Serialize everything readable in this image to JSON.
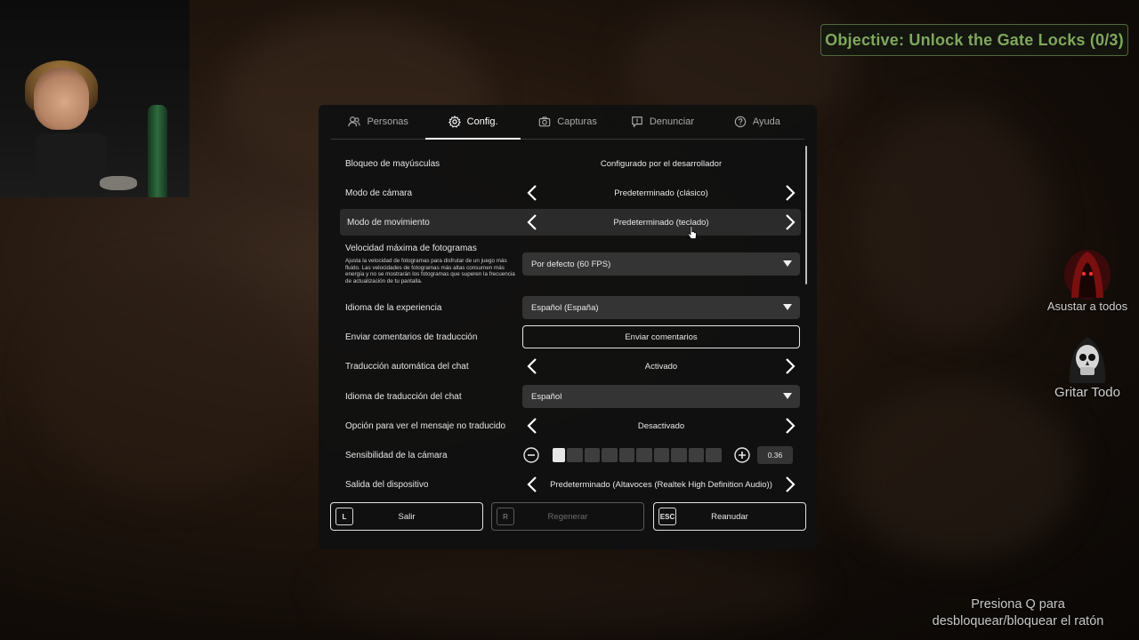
{
  "objective": "Objective: Unlock the Gate Locks (0/3)",
  "side_actions": [
    {
      "label": "Asustar a todos",
      "icon": "red-hooded-figure-icon"
    },
    {
      "label": "Gritar Todo",
      "icon": "skull-icon"
    }
  ],
  "hint": {
    "line1": "Presiona Q para",
    "line2": "desbloquear/bloquear el ratón"
  },
  "tabs": [
    {
      "label": "Personas",
      "icon": "people-icon",
      "active": false
    },
    {
      "label": "Config.",
      "icon": "gear-icon",
      "active": true
    },
    {
      "label": "Capturas",
      "icon": "camera-icon",
      "active": false
    },
    {
      "label": "Denunciar",
      "icon": "flag-report-icon",
      "active": false
    },
    {
      "label": "Ayuda",
      "icon": "help-icon",
      "active": false
    }
  ],
  "settings": {
    "caps_lock": {
      "label": "Bloqueo de mayúsculas",
      "value": "Configurado por el desarrollador"
    },
    "camera_mode": {
      "label": "Modo de cámara",
      "value": "Predeterminado (clásico)"
    },
    "movement_mode": {
      "label": "Modo de movimiento",
      "value": "Predeterminado (teclado)"
    },
    "max_fps": {
      "label": "Velocidad máxima de fotogramas",
      "description": "Ajusta la velocidad de fotogramas para disfrutar de un juego más fluido. Las velocidades de fotogramas más altas consumen más energía y no se mostrarán los fotogramas que superen la frecuencia de actualización de tu pantalla.",
      "value": "Por defecto (60 FPS)"
    },
    "experience_language": {
      "label": "Idioma de la experiencia",
      "value": "Español (España)"
    },
    "translation_feedback": {
      "label": "Enviar comentarios de traducción",
      "button": "Enviar comentarios"
    },
    "chat_auto_translate": {
      "label": "Traducción automática del chat",
      "value": "Activado"
    },
    "chat_translate_language": {
      "label": "Idioma de traducción del chat",
      "value": "Español"
    },
    "untranslated_message": {
      "label": "Opción para ver el mensaje no traducido",
      "value": "Desactivado"
    },
    "camera_sensitivity": {
      "label": "Sensibilidad de la cámara",
      "value": "0.36",
      "level": 0.1
    },
    "output_device": {
      "label": "Salida del dispositivo",
      "value": "Predeterminado (Altavoces (Realtek High Definition Audio))"
    }
  },
  "bottom_buttons": [
    {
      "key": "L",
      "label": "Salir",
      "enabled": true
    },
    {
      "key": "R",
      "label": "Regenerar",
      "enabled": false
    },
    {
      "key": "ESC",
      "label": "Reanudar",
      "enabled": true
    }
  ],
  "colors": {
    "objective": "#7fa85c",
    "panel": "#111111",
    "highlight": "#2b2b2b"
  }
}
